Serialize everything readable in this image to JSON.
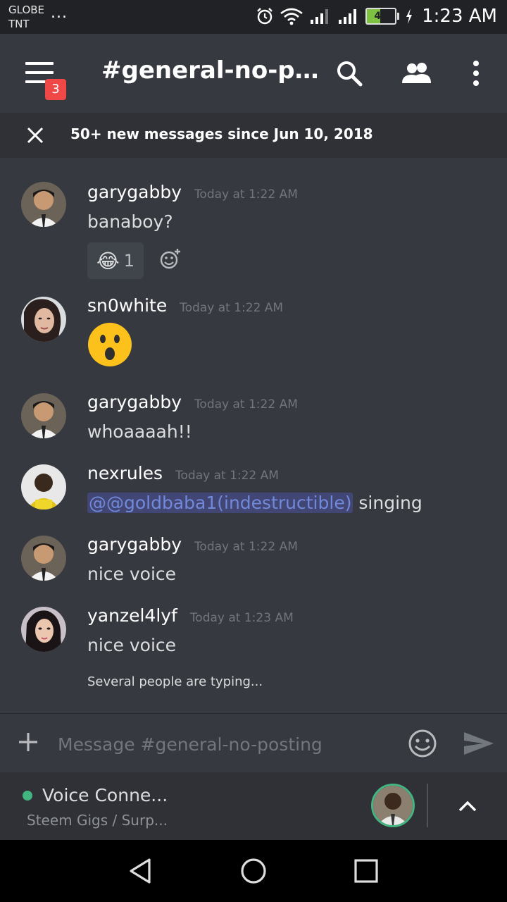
{
  "status_bar": {
    "carrier_line1": "GLOBE",
    "carrier_line2": "TNT",
    "dots": "...",
    "battery_level": "47",
    "time": "1:23 AM",
    "icons": [
      "alarm-icon",
      "wifi-icon",
      "signal-icon",
      "signal-icon",
      "battery-icon",
      "charging-icon"
    ]
  },
  "header": {
    "menu_badge": "3",
    "channel_name": "#general-no-posting",
    "icons": [
      "menu-icon",
      "search-icon",
      "members-icon",
      "more-icon"
    ]
  },
  "new_messages_bar": {
    "text": "50+ new messages since Jun 10, 2018"
  },
  "messages": [
    {
      "author": "garygabby",
      "timestamp": "Today at 1:22 AM",
      "content": "banaboy?",
      "reaction": {
        "emoji": "😂",
        "count": "1"
      }
    },
    {
      "author": "sn0white",
      "timestamp": "Today at 1:22 AM",
      "emoji": "😮"
    },
    {
      "author": "garygabby",
      "timestamp": "Today at 1:22 AM",
      "content": "whoaaaah!!"
    },
    {
      "author": "nexrules",
      "timestamp": "Today at 1:22 AM",
      "mention": "@@goldbaba1(indestructible)",
      "content": "singing"
    },
    {
      "author": "garygabby",
      "timestamp": "Today at 1:22 AM",
      "content": "nice voice"
    },
    {
      "author": "yanzel4lyf",
      "timestamp": "Today at 1:23 AM",
      "content": "nice voice"
    }
  ],
  "typing_indicator": "Several people are typing...",
  "input": {
    "placeholder": "Message #general-no-posting",
    "value": ""
  },
  "voice": {
    "title": "Voice Conne...",
    "subtitle": "Steem Gigs / Surp...",
    "status_color": "#43b581"
  },
  "colors": {
    "accent": "#7289da",
    "background": "#36393f",
    "badge": "#f04747"
  }
}
